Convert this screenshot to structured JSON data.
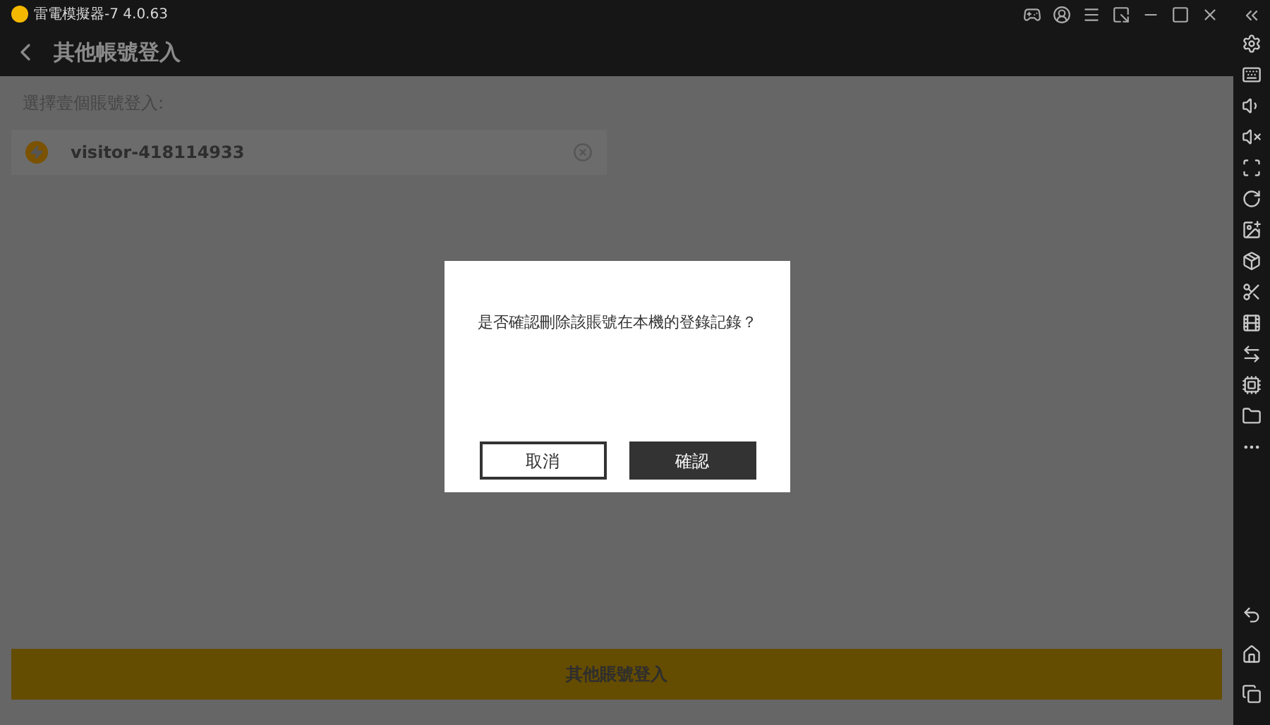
{
  "window": {
    "title": "雷電模擬器-7 4.0.63"
  },
  "header": {
    "title": "其他帳號登入"
  },
  "prompt": "選擇壹個賬號登入:",
  "accounts": [
    {
      "name": "visitor-418114933"
    }
  ],
  "bottom_button": "其他賬號登入",
  "dialog": {
    "message": "是否確認刪除該賬號在本機的登錄記錄？",
    "buttons": [
      {
        "label": "取消",
        "kind": "secondary"
      },
      {
        "label": "確認",
        "kind": "primary"
      }
    ]
  }
}
